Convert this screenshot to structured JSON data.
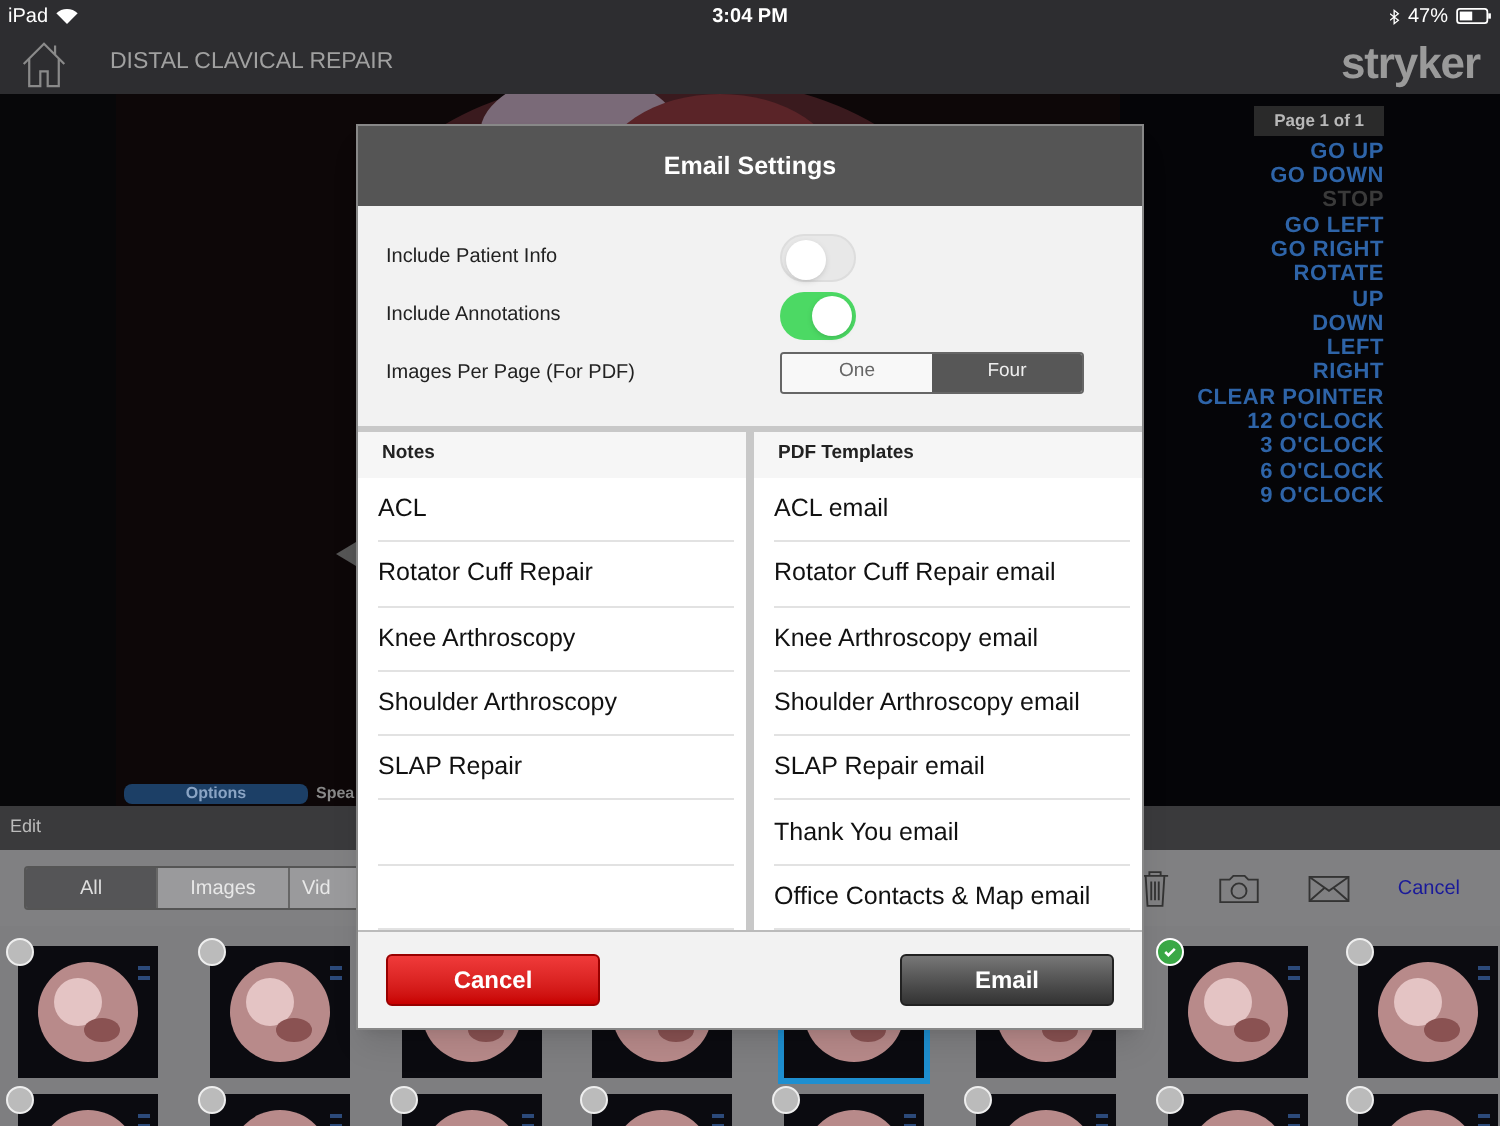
{
  "status_bar": {
    "device": "iPad",
    "time": "3:04 PM",
    "battery": "47%"
  },
  "header": {
    "title": "DISTAL CLAVICAL REPAIR",
    "logo": "stryker"
  },
  "video": {
    "page_label": "Page 1 of 1",
    "commands": [
      {
        "label": "GO UP",
        "disabled": false
      },
      {
        "label": "GO DOWN",
        "disabled": false
      },
      {
        "label": "STOP",
        "disabled": true
      },
      {
        "label": "GO LEFT",
        "disabled": false
      },
      {
        "label": "GO RIGHT",
        "disabled": false
      },
      {
        "label": "ROTATE",
        "disabled": false
      },
      {
        "label": "UP",
        "disabled": false
      },
      {
        "label": "DOWN",
        "disabled": false
      },
      {
        "label": "LEFT",
        "disabled": false
      },
      {
        "label": "RIGHT",
        "disabled": false
      },
      {
        "label": "CLEAR POINTER",
        "disabled": false
      },
      {
        "label": "12 O'CLOCK",
        "disabled": false
      },
      {
        "label": "3 O'CLOCK",
        "disabled": false
      },
      {
        "label": "6 O'CLOCK",
        "disabled": false
      },
      {
        "label": "9 O'CLOCK",
        "disabled": false
      }
    ],
    "tabs": [
      {
        "label": "Options",
        "selected": true
      },
      {
        "label": "Spea",
        "selected": false
      }
    ]
  },
  "edit_bar": {
    "label": "Edit"
  },
  "toolbar": {
    "filters": [
      {
        "label": "All",
        "selected": true
      },
      {
        "label": "Images",
        "selected": false
      },
      {
        "label": "Vid",
        "selected": false
      }
    ],
    "cancel": "Cancel"
  },
  "thumbnails": [
    {
      "highlighted": false,
      "checked": false
    },
    {
      "highlighted": false,
      "checked": false
    },
    {
      "highlighted": false
    },
    {
      "highlighted": false
    },
    {
      "highlighted": true
    },
    {
      "highlighted": false
    },
    {
      "highlighted": false,
      "checked": true
    },
    {
      "highlighted": false,
      "checked": false
    },
    {
      "highlighted": false,
      "checked": false
    },
    {
      "highlighted": false,
      "checked": false
    },
    {
      "highlighted": false,
      "checked": false
    },
    {
      "highlighted": false,
      "checked": false
    },
    {
      "highlighted": false,
      "checked": false
    },
    {
      "highlighted": false,
      "checked": false
    },
    {
      "highlighted": false,
      "checked": false
    },
    {
      "highlighted": false,
      "checked": false
    }
  ],
  "dialog": {
    "title": "Email Settings",
    "settings": [
      {
        "kind": "toggle",
        "label": "Include Patient Info",
        "on": false
      },
      {
        "kind": "toggle",
        "label": "Include Annotations",
        "on": true
      },
      {
        "kind": "segmented",
        "label": "Images Per Page (For PDF)",
        "options": [
          {
            "label": "One",
            "selected": false
          },
          {
            "label": "Four",
            "selected": true
          }
        ]
      }
    ],
    "notes": {
      "heading": "Notes",
      "items": [
        "ACL",
        "Rotator Cuff Repair",
        "Knee Arthroscopy",
        "Shoulder Arthroscopy",
        "SLAP Repair"
      ]
    },
    "templates": {
      "heading": "PDF Templates",
      "items": [
        "ACL email",
        "Rotator Cuff Repair email",
        "Knee Arthroscopy email",
        "Shoulder Arthroscopy email",
        "SLAP Repair email",
        "Thank You email",
        "Office Contacts & Map email"
      ]
    },
    "cancel": "Cancel",
    "confirm": "Email"
  }
}
